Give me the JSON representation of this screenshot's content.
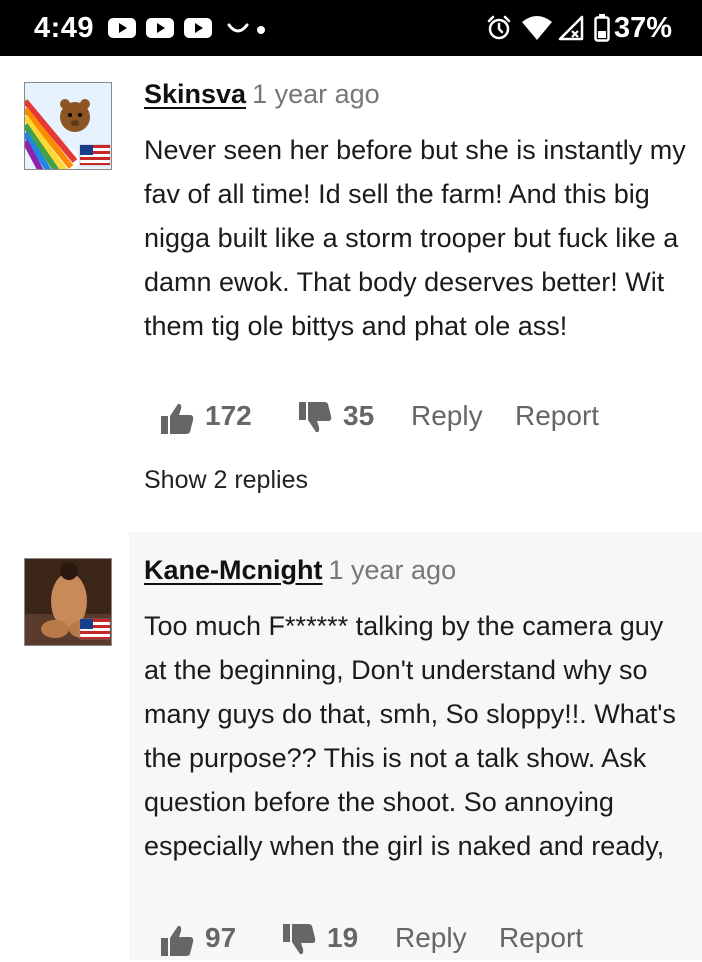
{
  "status_bar": {
    "time": "4:49",
    "battery_percent": "37%",
    "icons": [
      "youtube-icon",
      "youtube-icon",
      "youtube-icon",
      "smile-icon",
      "dot-icon",
      "alarm-icon",
      "wifi-icon",
      "signal-icon",
      "battery-icon"
    ]
  },
  "comments": [
    {
      "username": "Skinsva",
      "time_ago": "1 year ago",
      "text": "Never seen her before but she is instantly my fav of all time! Id sell the farm! And this big nigga built like a storm trooper but fuck like a damn ewok. That body deserves better! Wit them tig ole bittys and phat ole ass!",
      "likes": "172",
      "dislikes": "35",
      "reply_label": "Reply",
      "report_label": "Report",
      "show_replies": "Show 2 replies"
    },
    {
      "username": "Kane-Mcnight",
      "time_ago": "1 year ago",
      "text": "Too much F****** talking by the camera guy at the beginning, Don't understand why so many guys do that, smh, So sloppy!!. What's the purpose?? This is not a talk show. Ask question before the shoot. So annoying especially when the girl is naked and ready,",
      "likes": "97",
      "dislikes": "19",
      "reply_label": "Reply",
      "report_label": "Report"
    }
  ],
  "colors": {
    "status_bar_bg": "#000000",
    "text": "#1b1b1b",
    "muted": "#777777",
    "action_gray": "#666666",
    "shaded_bg": "#f7f7f7"
  }
}
